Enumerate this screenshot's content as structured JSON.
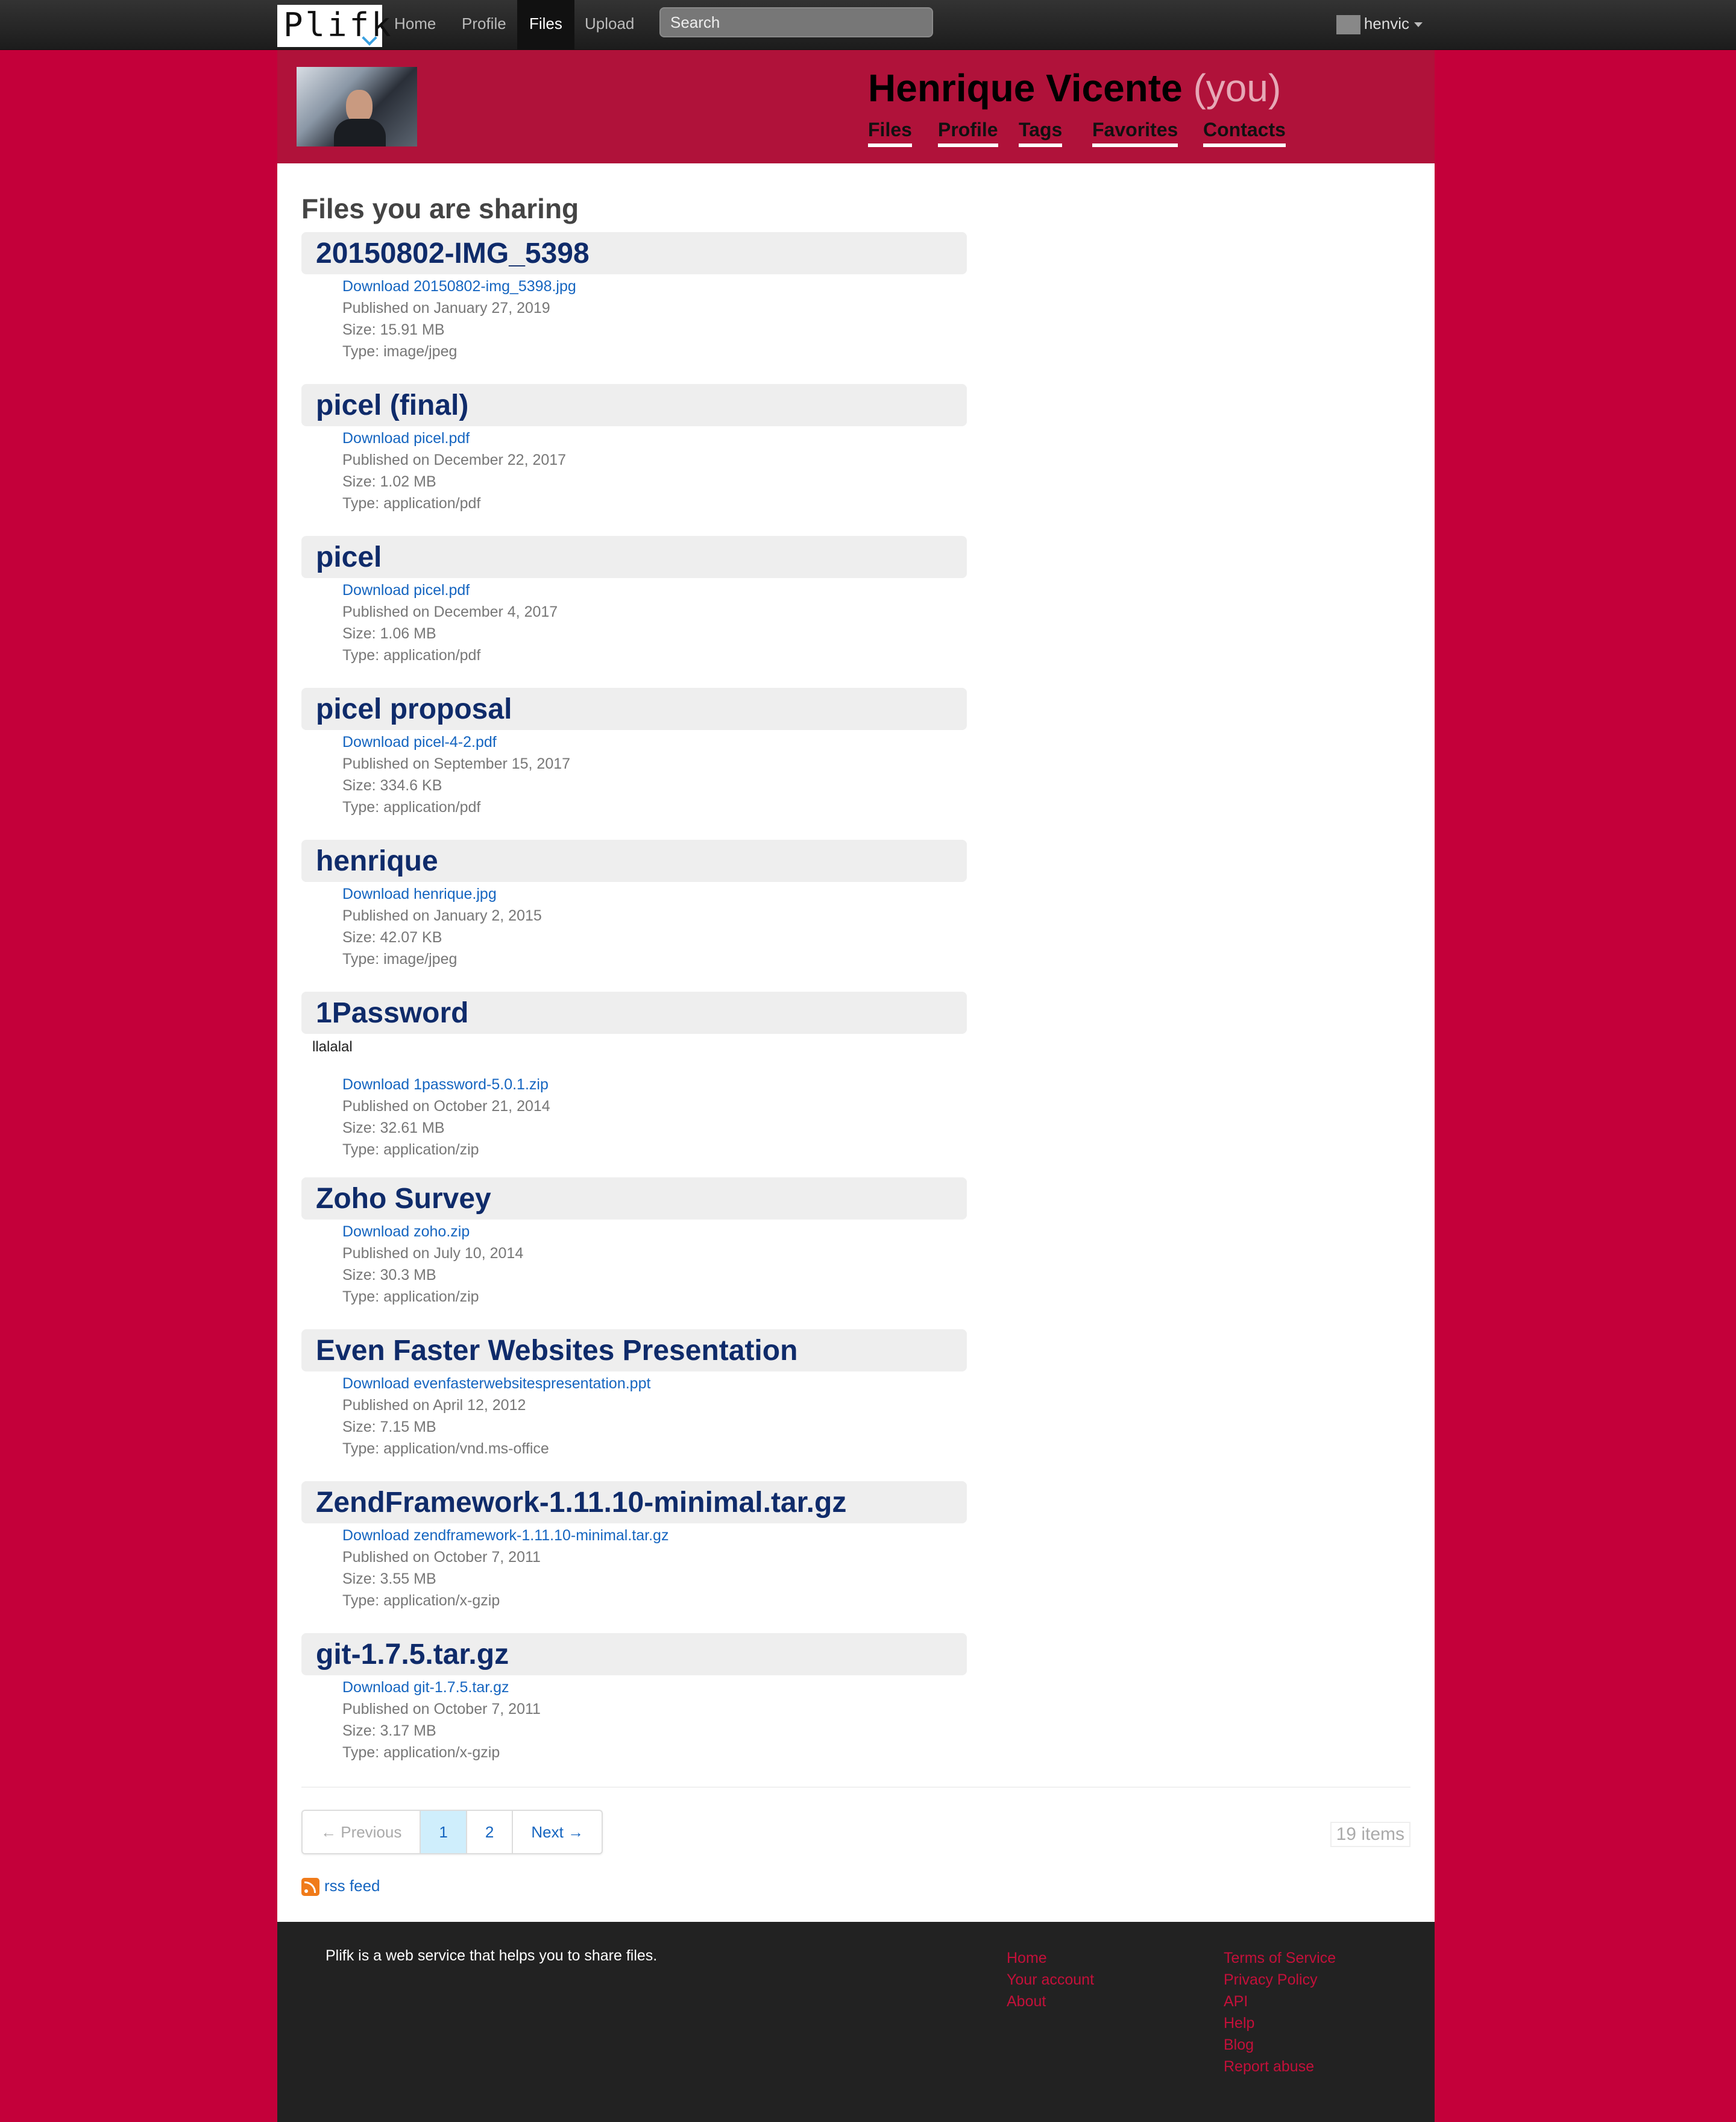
{
  "topnav": {
    "logo": "Plifk",
    "links": [
      "Home",
      "Profile",
      "Files",
      "Upload"
    ],
    "active": "Files",
    "search_placeholder": "Search",
    "username": "henvic"
  },
  "profile": {
    "name": "Henrique Vicente",
    "you_label": "(you)",
    "tabs": [
      "Files",
      "Profile",
      "Tags",
      "Favorites",
      "Contacts"
    ]
  },
  "main": {
    "heading": "Files you are sharing",
    "files": [
      {
        "title": "20150802-IMG_5398",
        "description": "",
        "download": "Download 20150802-img_5398.jpg",
        "published": "Published on January 27, 2019",
        "size": "Size: 15.91 MB",
        "type": "Type: image/jpeg"
      },
      {
        "title": "picel (final)",
        "description": "",
        "download": "Download picel.pdf",
        "published": "Published on December 22, 2017",
        "size": "Size: 1.02 MB",
        "type": "Type: application/pdf"
      },
      {
        "title": "picel",
        "description": "",
        "download": "Download picel.pdf",
        "published": "Published on December 4, 2017",
        "size": "Size: 1.06 MB",
        "type": "Type: application/pdf"
      },
      {
        "title": "picel proposal",
        "description": "",
        "download": "Download picel-4-2.pdf",
        "published": "Published on September 15, 2017",
        "size": "Size: 334.6 KB",
        "type": "Type: application/pdf"
      },
      {
        "title": "henrique",
        "description": "",
        "download": "Download henrique.jpg",
        "published": "Published on January 2, 2015",
        "size": "Size: 42.07 KB",
        "type": "Type: image/jpeg"
      },
      {
        "title": "1Password",
        "description": "llalalal",
        "download": "Download 1password-5.0.1.zip",
        "published": "Published on October 21, 2014",
        "size": "Size: 32.61 MB",
        "type": "Type: application/zip"
      },
      {
        "title": "Zoho Survey",
        "description": "",
        "download": "Download zoho.zip",
        "published": "Published on July 10, 2014",
        "size": "Size: 30.3 MB",
        "type": "Type: application/zip"
      },
      {
        "title": "Even Faster Websites Presentation",
        "description": "",
        "download": "Download evenfasterwebsitespresentation.ppt",
        "published": "Published on April 12, 2012",
        "size": "Size: 7.15 MB",
        "type": "Type: application/vnd.ms-office"
      },
      {
        "title": "ZendFramework-1.11.10-minimal.tar.gz",
        "description": "",
        "download": "Download zendframework-1.11.10-minimal.tar.gz",
        "published": "Published on October 7, 2011",
        "size": "Size: 3.55 MB",
        "type": "Type: application/x-gzip"
      },
      {
        "title": "git-1.7.5.tar.gz",
        "description": "",
        "download": "Download git-1.7.5.tar.gz",
        "published": "Published on October 7, 2011",
        "size": "Size: 3.17 MB",
        "type": "Type: application/x-gzip"
      }
    ],
    "pagination": {
      "previous": "← Previous",
      "pages": [
        "1",
        "2"
      ],
      "current": "1",
      "next": "Next →"
    },
    "items_count": "19 items",
    "rss": "rss feed"
  },
  "footer": {
    "tagline": "Plifk is a web service that helps you to share files.",
    "col1": [
      "Home",
      "Your account",
      "About"
    ],
    "col2": [
      "Terms of Service",
      "Privacy Policy",
      "API",
      "Help",
      "Blog",
      "Report abuse"
    ]
  },
  "colors": {
    "brand": "#c4003a",
    "header": "#b0123a",
    "title": "#0f2b6a",
    "link": "#1565c0"
  }
}
